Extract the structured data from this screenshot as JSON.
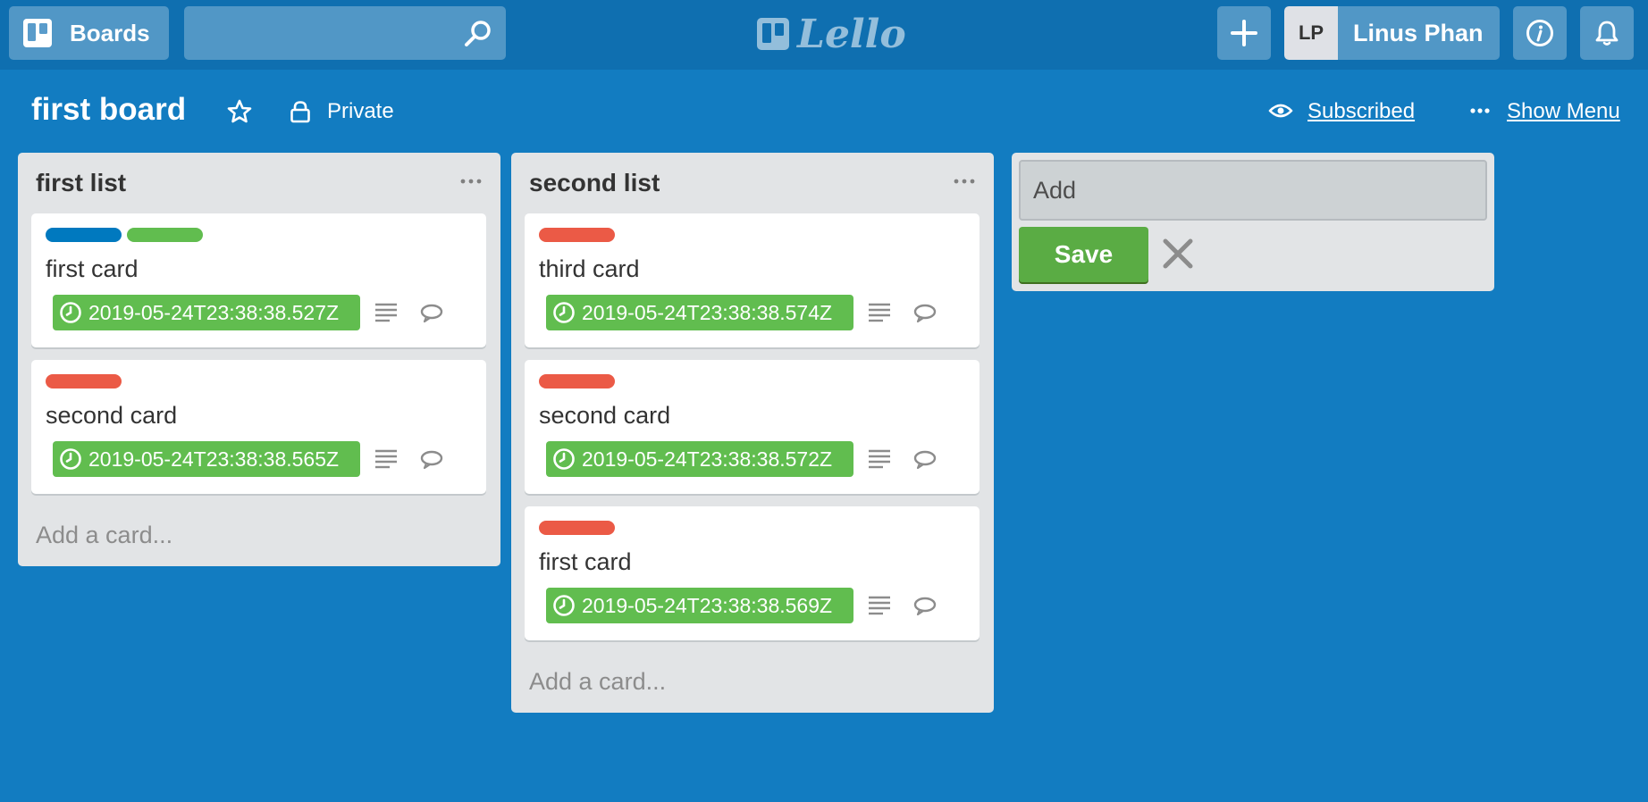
{
  "header": {
    "boards_label": "Boards",
    "search": {
      "value": "",
      "placeholder": ""
    },
    "logo_text": "Lello",
    "user": {
      "initials": "LP",
      "name": "Linus Phan"
    }
  },
  "board": {
    "title": "first board",
    "privacy": "Private",
    "subscribed_label": "Subscribed",
    "menu_label": "Show Menu"
  },
  "lists": [
    {
      "title": "first list",
      "add_card": "Add a card...",
      "cards": [
        {
          "labels": [
            "#0079bf",
            "#61bd4f"
          ],
          "title": "first card",
          "due": "2019-05-24T23:38:38.527Z"
        },
        {
          "labels": [
            "#eb5a46"
          ],
          "title": "second card",
          "due": "2019-05-24T23:38:38.565Z"
        }
      ]
    },
    {
      "title": "second list",
      "add_card": "Add a card...",
      "cards": [
        {
          "labels": [
            "#eb5a46"
          ],
          "title": "third card",
          "due": "2019-05-24T23:38:38.574Z"
        },
        {
          "labels": [
            "#eb5a46"
          ],
          "title": "second card",
          "due": "2019-05-24T23:38:38.572Z"
        },
        {
          "labels": [
            "#eb5a46"
          ],
          "title": "first card",
          "due": "2019-05-24T23:38:38.569Z"
        }
      ]
    }
  ],
  "add_list": {
    "input_value": "",
    "placeholder": "Add",
    "save_label": "Save"
  },
  "colors": {
    "background": "#127cc1",
    "header": "#0f6fb0",
    "due_badge": "#61bd4f",
    "save_button": "#5aac44"
  }
}
